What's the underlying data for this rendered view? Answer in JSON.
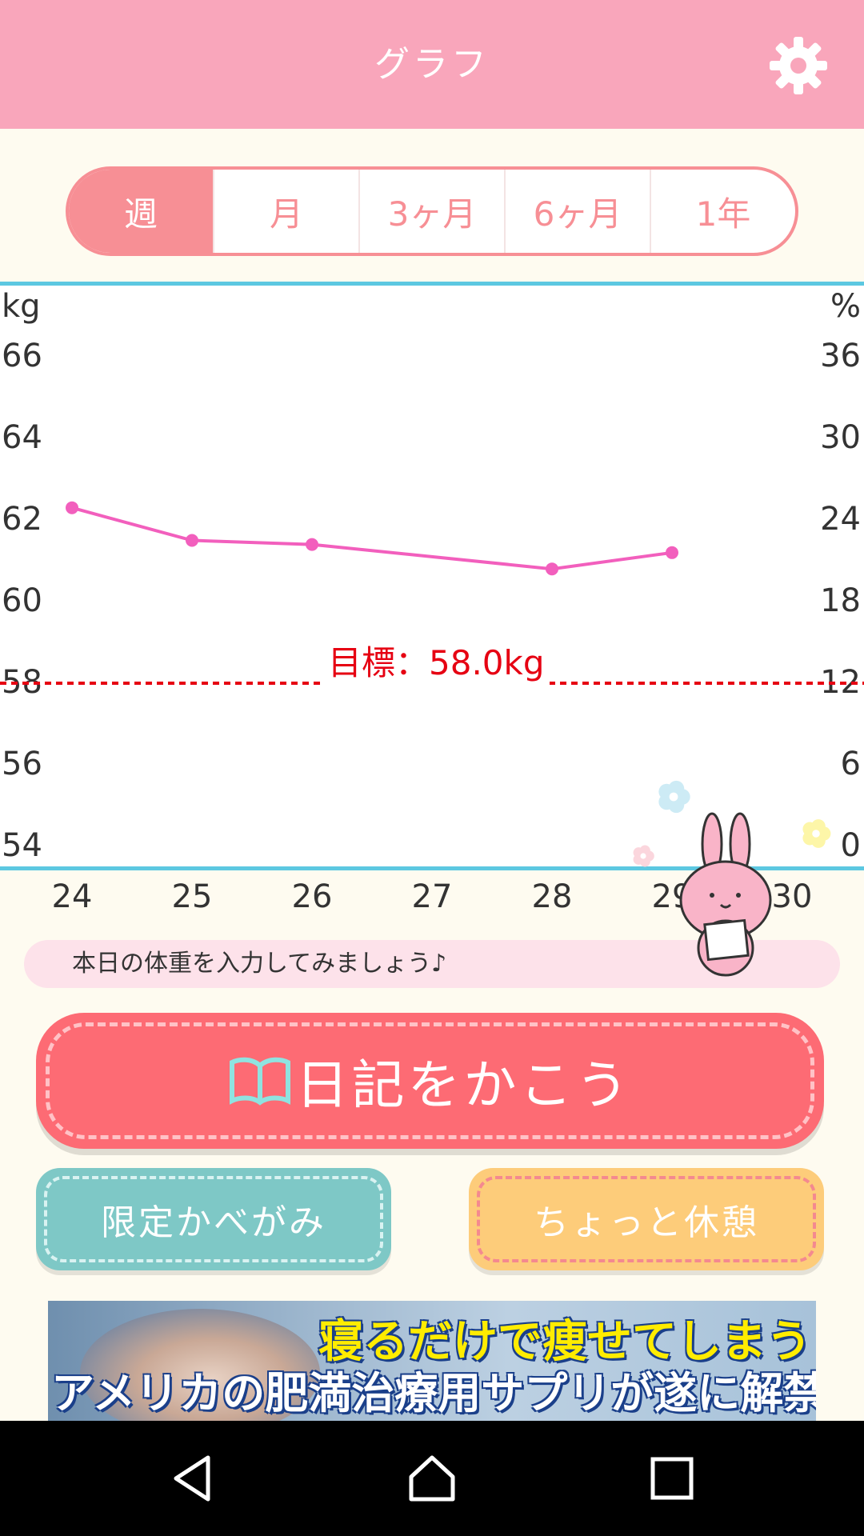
{
  "header": {
    "title": "グラフ",
    "settings_icon": "gear-icon"
  },
  "tabs": [
    {
      "label": "週",
      "active": true
    },
    {
      "label": "月",
      "active": false
    },
    {
      "label": "3ヶ月",
      "active": false
    },
    {
      "label": "6ヶ月",
      "active": false
    },
    {
      "label": "1年",
      "active": false
    }
  ],
  "chart_data": {
    "type": "line",
    "left_unit": "kg",
    "right_unit": "%",
    "left_ticks": [
      "66",
      "64",
      "62",
      "60",
      "58",
      "56",
      "54"
    ],
    "right_ticks": [
      "36",
      "30",
      "24",
      "18",
      "12",
      "6",
      "0"
    ],
    "ylim": [
      54,
      66
    ],
    "x_ticks": [
      "24",
      "25",
      "26",
      "27",
      "28",
      "29",
      "30"
    ],
    "series": [
      {
        "color": "#f25fbd",
        "points": [
          {
            "x": 24,
            "y": 62.3
          },
          {
            "x": 25,
            "y": 61.5
          },
          {
            "x": 26,
            "y": 61.4
          },
          {
            "x": 28,
            "y": 60.8
          },
          {
            "x": 29,
            "y": 61.2
          }
        ]
      }
    ],
    "goal": {
      "value": 58.0,
      "label": "目標：58.0kg",
      "color": "#e60012"
    }
  },
  "message": "本日の体重を入力してみましょう♪",
  "buttons": {
    "diary": "日記をかこう",
    "wallpaper": "限定かべがみ",
    "break": "ちょっと休憩"
  },
  "ad": {
    "line1": "寝るだけで痩せてしまう",
    "line2": "アメリカの肥満治療用サプリが遂に解禁!"
  },
  "navbar": {
    "icons": [
      "back-icon",
      "home-icon",
      "recents-icon"
    ]
  },
  "colors": {
    "header": "#f9a6bb",
    "accent": "#f78f95",
    "chart_border": "#5cc8e1",
    "line": "#f25fbd"
  }
}
